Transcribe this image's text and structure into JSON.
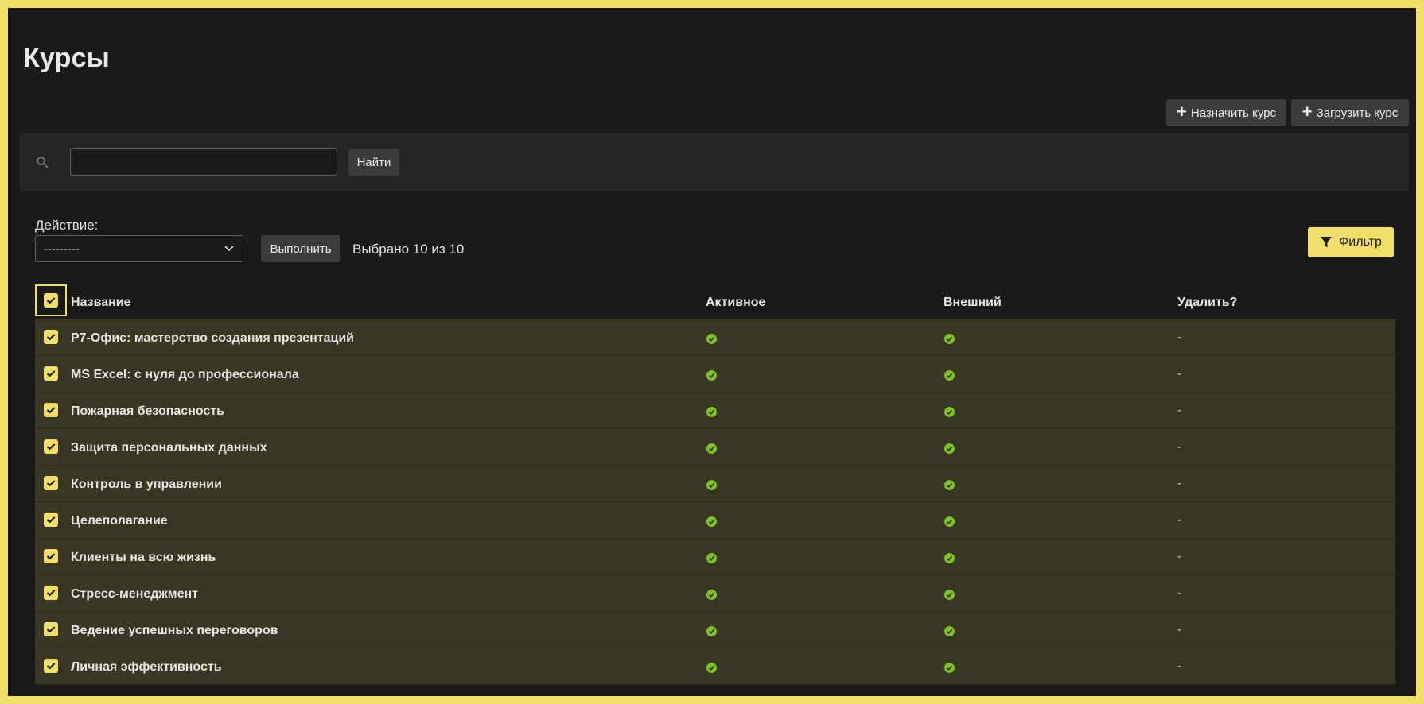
{
  "page": {
    "title": "Курсы"
  },
  "toolbar": {
    "assign_label": "Назначить курс",
    "upload_label": "Загрузить курс"
  },
  "search": {
    "value": "",
    "button_label": "Найти"
  },
  "actions": {
    "label": "Действие:",
    "selected_option": "---------",
    "run_label": "Выполнить",
    "selected_count": "Выбрано 10 из 10"
  },
  "filter": {
    "label": "Фильтр"
  },
  "table": {
    "headers": {
      "name": "Название",
      "active": "Активное",
      "external": "Внешний",
      "delete": "Удалить?"
    },
    "rows": [
      {
        "name": "Р7-Офис: мастерство создания презентаций",
        "active": true,
        "external": true,
        "delete": "-",
        "checked": true
      },
      {
        "name": "MS Excel: с нуля до профессионала",
        "active": true,
        "external": true,
        "delete": "-",
        "checked": true
      },
      {
        "name": "Пожарная безопасность",
        "active": true,
        "external": true,
        "delete": "-",
        "checked": true
      },
      {
        "name": "Защита персональных данных",
        "active": true,
        "external": true,
        "delete": "-",
        "checked": true
      },
      {
        "name": "Контроль в управлении",
        "active": true,
        "external": true,
        "delete": "-",
        "checked": true
      },
      {
        "name": "Целеполагание",
        "active": true,
        "external": true,
        "delete": "-",
        "checked": true
      },
      {
        "name": "Клиенты на всю жизнь",
        "active": true,
        "external": true,
        "delete": "-",
        "checked": true
      },
      {
        "name": "Стресс-менеджмент",
        "active": true,
        "external": true,
        "delete": "-",
        "checked": true
      },
      {
        "name": "Ведение успешных переговоров",
        "active": true,
        "external": true,
        "delete": "-",
        "checked": true
      },
      {
        "name": "Личная эффективность",
        "active": true,
        "external": true,
        "delete": "-",
        "checked": true
      }
    ]
  },
  "colors": {
    "accent": "#f2de6b",
    "background": "#1a1a1a",
    "row_selected": "#393623",
    "status_ok": "#7cc423"
  },
  "icons": {
    "search": "search-icon",
    "plus": "plus-icon",
    "filter": "filter-icon",
    "chevron": "chevron-down-icon",
    "check": "check-icon",
    "status": "check-circle-icon"
  }
}
